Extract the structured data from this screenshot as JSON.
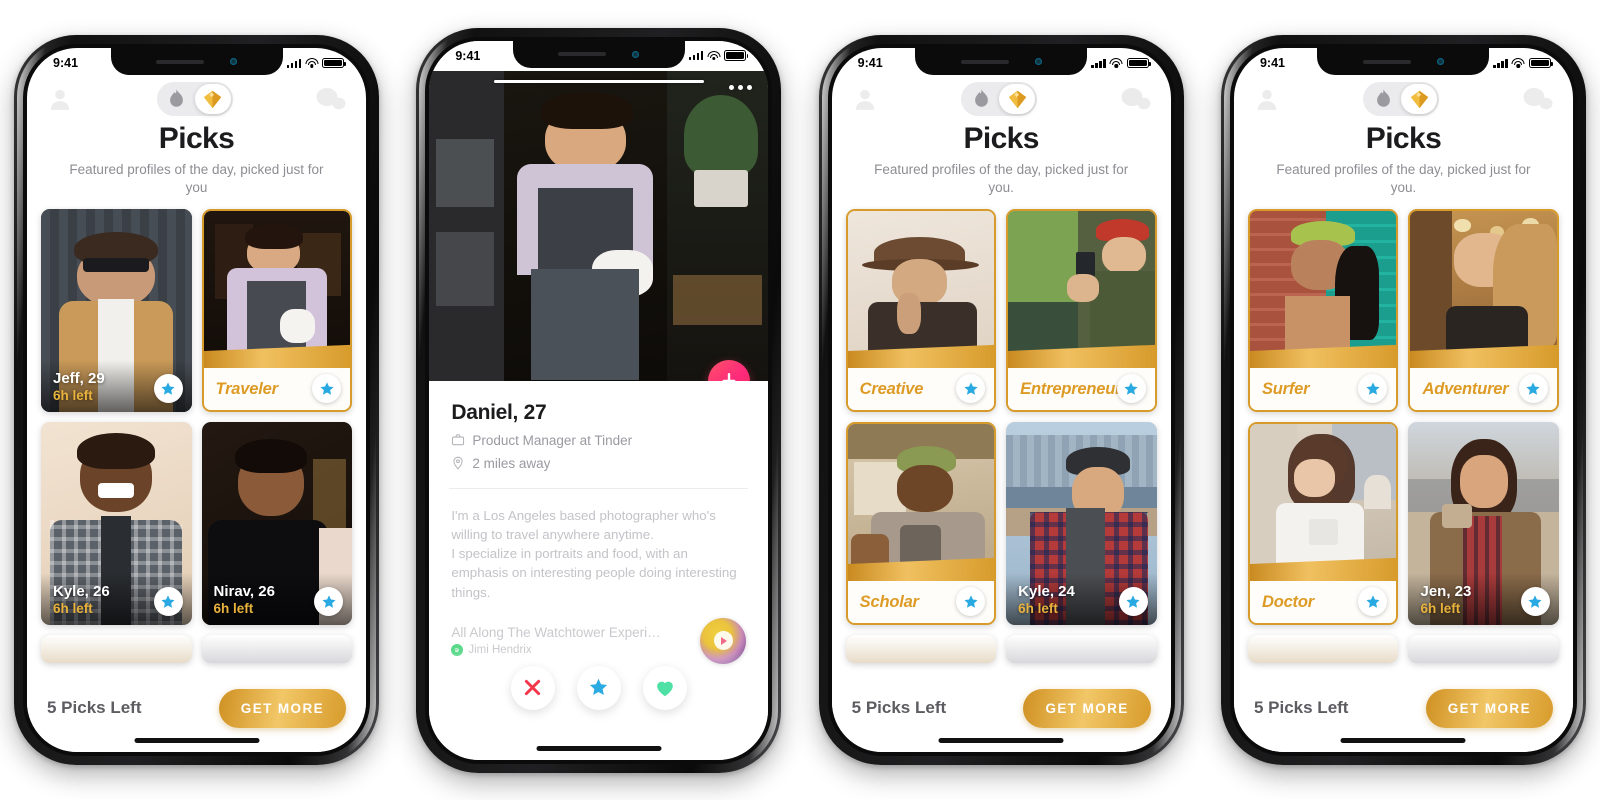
{
  "status_bar": {
    "time": "9:41",
    "signal_icon": "cellular-signal-icon",
    "wifi_icon": "wifi-icon",
    "battery_icon": "battery-icon"
  },
  "header": {
    "profile_icon": "person-icon",
    "chat_icon": "chat-bubble-icon",
    "toggle": {
      "flame_label": "tinder-flame-icon",
      "gold_label": "gold-diamond-icon",
      "selected": "gold"
    },
    "title": "Picks",
    "subtitle_no_period": "Featured profiles of the day,\npicked just for you",
    "subtitle_period": "Featured profiles of the day,\npicked just for you."
  },
  "bottom_bar": {
    "picks_left": "5 Picks Left",
    "get_more_label": "GET MORE",
    "accent_gold": "#d79b2b"
  },
  "colors": {
    "gold": "#dd9b25",
    "star_blue": "#29a9e1",
    "time_gold": "#e8b23c",
    "nope_red": "#f4364c",
    "like_green": "#4fe0a5",
    "rewind_pink": "#fd297b"
  },
  "screens": [
    {
      "name": "picks-grid-men",
      "subtitle": "Featured profiles of the day,\npicked just for you",
      "cards": [
        {
          "type": "name",
          "name": "Jeff, 29",
          "time": "6h left",
          "star": "superlike-star-icon",
          "bg": "jeff"
        },
        {
          "type": "badge",
          "label": "Traveler",
          "star": "superlike-star-icon",
          "bg": "traveler"
        },
        {
          "type": "name",
          "name": "Kyle, 26",
          "time": "6h left",
          "star": "superlike-star-icon",
          "bg": "kyle26"
        },
        {
          "type": "name",
          "name": "Nirav, 26",
          "time": "6h left",
          "star": "superlike-star-icon",
          "bg": "nirav"
        }
      ]
    },
    {
      "name": "profile-detail",
      "profile": {
        "name": "Daniel, 27",
        "job_icon": "briefcase-icon",
        "job": "Product Manager at Tinder",
        "location_icon": "location-pin-icon",
        "distance": "2 miles away",
        "bio": "I'm a Los Angeles based photographer who's willing to travel anywhere anytime.\nI specialize in portraits and food, with an emphasis on interesting people doing interesting things.",
        "anthem_title": "All Along The Watchtower Experien...",
        "anthem_artist": "Jimi Hendrix",
        "anthem_play_icon": "play-icon",
        "spotify_icon": "spotify-icon",
        "rewind_icon": "rewind-arrow-down-icon",
        "more_icon": "more-dots-icon"
      },
      "actions": [
        {
          "icon": "nope-x-icon",
          "label": "Nope"
        },
        {
          "icon": "superlike-star-icon",
          "label": "Super Like"
        },
        {
          "icon": "like-heart-icon",
          "label": "Like"
        }
      ]
    },
    {
      "name": "picks-grid-mixed",
      "subtitle": "Featured profiles of the day,\npicked just for you.",
      "cards": [
        {
          "type": "badge",
          "label": "Creative",
          "star": "superlike-star-icon",
          "bg": "creative"
        },
        {
          "type": "badge",
          "label": "Entrepreneur",
          "star": "superlike-star-icon",
          "bg": "entrepreneur"
        },
        {
          "type": "badge",
          "label": "Scholar",
          "star": "superlike-star-icon",
          "bg": "scholar"
        },
        {
          "type": "name",
          "name": "Kyle, 24",
          "time": "6h left",
          "star": "superlike-star-icon",
          "bg": "kyle24"
        }
      ]
    },
    {
      "name": "picks-grid-women",
      "subtitle": "Featured profiles of the day,\npicked just for you.",
      "cards": [
        {
          "type": "badge",
          "label": "Surfer",
          "star": "superlike-star-icon",
          "bg": "surfer"
        },
        {
          "type": "badge",
          "label": "Adventurer",
          "star": "superlike-star-icon",
          "bg": "adventurer"
        },
        {
          "type": "badge",
          "label": "Doctor",
          "star": "superlike-star-icon",
          "bg": "doctor"
        },
        {
          "type": "name",
          "name": "Jen, 23",
          "time": "6h left",
          "star": "superlike-star-icon",
          "bg": "jen"
        }
      ]
    }
  ]
}
